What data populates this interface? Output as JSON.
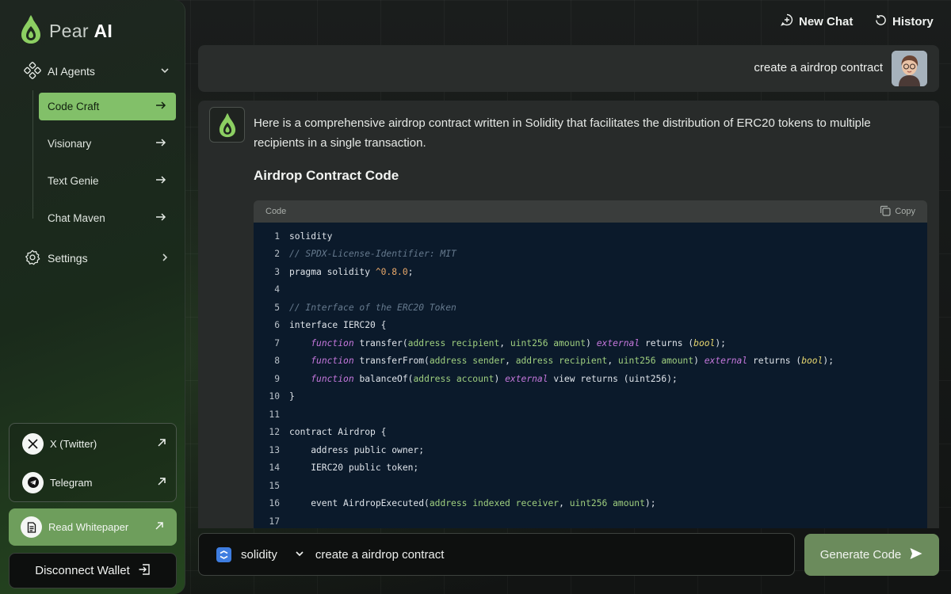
{
  "brand": {
    "name_prefix": "Pear",
    "name_suffix": "AI"
  },
  "sidebar": {
    "agents_label": "AI Agents",
    "children": [
      {
        "label": "Code Craft",
        "active": true
      },
      {
        "label": "Visionary",
        "active": false
      },
      {
        "label": "Text Genie",
        "active": false
      },
      {
        "label": "Chat Maven",
        "active": false
      }
    ],
    "settings_label": "Settings",
    "socials": [
      {
        "label": "X (Twitter)",
        "icon": "x-logo-icon"
      },
      {
        "label": "Telegram",
        "icon": "telegram-icon"
      }
    ],
    "whitepaper_label": "Read Whitepaper",
    "disconnect_label": "Disconnect Wallet"
  },
  "topbar": {
    "new_chat": "New Chat",
    "history": "History"
  },
  "chat": {
    "user_message": "create a airdrop contract",
    "ai_intro": "Here is a comprehensive airdrop contract written in Solidity that facilitates the distribution of ERC20 tokens to multiple recipients in a single transaction.",
    "ai_heading": "Airdrop Contract Code",
    "code_label": "Code",
    "copy_label": "Copy",
    "code_lines": [
      "solidity",
      "// SPDX-License-Identifier: MIT",
      "pragma solidity ^0.8.0;",
      "",
      "// Interface of the ERC20 Token",
      "interface IERC20 {",
      "    function transfer(address recipient, uint256 amount) external returns (bool);",
      "    function transferFrom(address sender, address recipient, uint256 amount) external returns (bool);",
      "    function balanceOf(address account) external view returns (uint256);",
      "}",
      "",
      "contract Airdrop {",
      "    address public owner;",
      "    IERC20 public token;",
      "",
      "    event AirdropExecuted(address indexed receiver, uint256 amount);",
      ""
    ]
  },
  "input": {
    "language": "solidity",
    "prompt": "create a airdrop contract",
    "generate_label": "Generate Code"
  },
  "colors": {
    "accent": "#82c069",
    "code_bg": "#0b1a2b",
    "generate_bg": "#6b8b5c"
  }
}
